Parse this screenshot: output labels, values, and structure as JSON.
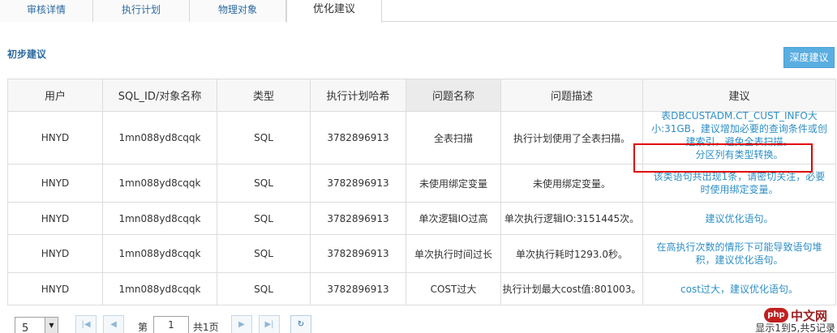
{
  "tabs": [
    {
      "label": "审核详情"
    },
    {
      "label": "执行计划"
    },
    {
      "label": "物理对象"
    },
    {
      "label": "优化建议"
    }
  ],
  "section_title": "初步建议",
  "deep_button": "深度建议",
  "table": {
    "headers": [
      "用户",
      "SQL_ID/对象名称",
      "类型",
      "执行计划哈希",
      "问题名称",
      "问题描述",
      "建议"
    ],
    "rows": [
      {
        "user": "HNYD",
        "sql_id": "1mn088yd8cqqk",
        "type": "SQL",
        "hash": "3782896913",
        "problem": "全表扫描",
        "desc": "执行计划使用了全表扫描。",
        "advice_lines": [
          "表DBCUSTADM.CT_CUST_INFO大",
          "小:31GB，建议增加必要的查询条件或创",
          "建索引，避免全表扫描。",
          "分区列有类型转换。"
        ]
      },
      {
        "user": "HNYD",
        "sql_id": "1mn088yd8cqqk",
        "type": "SQL",
        "hash": "3782896913",
        "problem": "未使用绑定变量",
        "desc": "未使用绑定变量。",
        "advice_lines": [
          "该类语句共出现1条，请密切关注，必要",
          "时使用绑定变量。"
        ]
      },
      {
        "user": "HNYD",
        "sql_id": "1mn088yd8cqqk",
        "type": "SQL",
        "hash": "3782896913",
        "problem": "单次逻辑IO过高",
        "desc": "单次执行逻辑IO:3151445次。",
        "advice_lines": [
          "建议优化语句。"
        ]
      },
      {
        "user": "HNYD",
        "sql_id": "1mn088yd8cqqk",
        "type": "SQL",
        "hash": "3782896913",
        "problem": "单次执行时间过长",
        "desc": "单次执行耗时1293.0秒。",
        "advice_lines": [
          "在高执行次数的情形下可能导致语句堆",
          "积，建议优化语句。"
        ]
      },
      {
        "user": "HNYD",
        "sql_id": "1mn088yd8cqqk",
        "type": "SQL",
        "hash": "3782896913",
        "problem": "COST过大",
        "desc": "执行计划最大cost值:801003。",
        "advice_lines": [
          "cost过大，建议优化语句。"
        ]
      }
    ]
  },
  "pager": {
    "page_size": "5",
    "page_prefix": "第",
    "page_value": "1",
    "page_suffix": "共1页",
    "summary": "显示1到5,共5记录"
  },
  "watermark": {
    "logo": "php",
    "text": "中文网"
  },
  "colors": {
    "accent": "#2c6aa0",
    "link": "#2e8fc4",
    "button": "#5aaee0",
    "highlight": "#e00000"
  }
}
